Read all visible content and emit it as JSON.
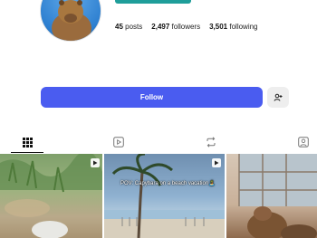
{
  "profile": {
    "stats": [
      {
        "count": "45",
        "label": "posts"
      },
      {
        "count": "2,497",
        "label": "followers"
      },
      {
        "count": "3,501",
        "label": "following"
      }
    ]
  },
  "actions": {
    "follow_label": "Follow"
  },
  "tabs": [
    "grid-icon",
    "video-icon",
    "repost-icon",
    "tagged-icon"
  ],
  "posts": [
    {
      "type": "video"
    },
    {
      "type": "video",
      "caption": "POV: Capybara on a beach vacation🏝️"
    },
    {
      "type": "image"
    }
  ],
  "colors": {
    "accent": "#4a5cf0",
    "teal": "#1f9e9a"
  }
}
